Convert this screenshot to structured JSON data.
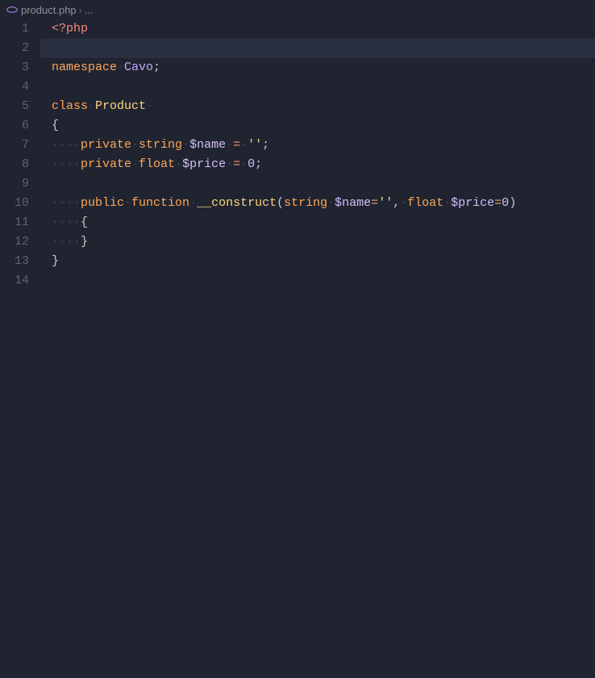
{
  "breadcrumb": {
    "filename": "product.php",
    "sep": "›",
    "tail": "..."
  },
  "iconColor": "#a074c4",
  "currentLine": 2,
  "lines": [
    {
      "n": 1,
      "tokens": [
        {
          "c": "tk-tag",
          "t": "<?php"
        }
      ]
    },
    {
      "n": 2,
      "tokens": []
    },
    {
      "n": 3,
      "tokens": [
        {
          "c": "tk-keyword",
          "t": "namespace"
        },
        {
          "c": "tk-ws",
          "t": "·"
        },
        {
          "c": "tk-ns",
          "t": "Cavo"
        },
        {
          "c": "tk-punct",
          "t": ";"
        }
      ]
    },
    {
      "n": 4,
      "tokens": []
    },
    {
      "n": 5,
      "tokens": [
        {
          "c": "tk-keyword",
          "t": "class"
        },
        {
          "c": "tk-ws",
          "t": "·"
        },
        {
          "c": "tk-class",
          "t": "Product"
        },
        {
          "c": "tk-ws",
          "t": "·"
        }
      ]
    },
    {
      "n": 6,
      "tokens": [
        {
          "c": "tk-punct",
          "t": "{"
        }
      ]
    },
    {
      "n": 7,
      "tokens": [
        {
          "c": "tk-ws",
          "t": "····"
        },
        {
          "c": "tk-keyword",
          "t": "private"
        },
        {
          "c": "tk-ws",
          "t": "·"
        },
        {
          "c": "tk-type",
          "t": "string"
        },
        {
          "c": "tk-ws",
          "t": "·"
        },
        {
          "c": "tk-var",
          "t": "$name"
        },
        {
          "c": "tk-ws",
          "t": "·"
        },
        {
          "c": "tk-op",
          "t": "="
        },
        {
          "c": "tk-ws",
          "t": "·"
        },
        {
          "c": "tk-str",
          "t": "''"
        },
        {
          "c": "tk-punct",
          "t": ";"
        }
      ]
    },
    {
      "n": 8,
      "tokens": [
        {
          "c": "tk-ws",
          "t": "····"
        },
        {
          "c": "tk-keyword",
          "t": "private"
        },
        {
          "c": "tk-ws",
          "t": "·"
        },
        {
          "c": "tk-type",
          "t": "float"
        },
        {
          "c": "tk-ws",
          "t": "·"
        },
        {
          "c": "tk-var",
          "t": "$price"
        },
        {
          "c": "tk-ws",
          "t": "·"
        },
        {
          "c": "tk-op",
          "t": "="
        },
        {
          "c": "tk-ws",
          "t": "·"
        },
        {
          "c": "tk-num",
          "t": "0"
        },
        {
          "c": "tk-punct",
          "t": ";"
        }
      ]
    },
    {
      "n": 9,
      "tokens": []
    },
    {
      "n": 10,
      "tokens": [
        {
          "c": "tk-ws",
          "t": "····"
        },
        {
          "c": "tk-keyword",
          "t": "public"
        },
        {
          "c": "tk-ws",
          "t": "·"
        },
        {
          "c": "tk-keyword",
          "t": "function"
        },
        {
          "c": "tk-ws",
          "t": "·"
        },
        {
          "c": "tk-func",
          "t": "__construct"
        },
        {
          "c": "tk-punct",
          "t": "("
        },
        {
          "c": "tk-type",
          "t": "string"
        },
        {
          "c": "tk-ws",
          "t": "·"
        },
        {
          "c": "tk-var",
          "t": "$name"
        },
        {
          "c": "tk-op",
          "t": "="
        },
        {
          "c": "tk-str",
          "t": "''"
        },
        {
          "c": "tk-punct",
          "t": ","
        },
        {
          "c": "tk-ws",
          "t": "·"
        },
        {
          "c": "tk-type",
          "t": "float"
        },
        {
          "c": "tk-ws",
          "t": "·"
        },
        {
          "c": "tk-var",
          "t": "$price"
        },
        {
          "c": "tk-op",
          "t": "="
        },
        {
          "c": "tk-num",
          "t": "0"
        },
        {
          "c": "tk-punct",
          "t": ")"
        }
      ]
    },
    {
      "n": 11,
      "tokens": [
        {
          "c": "tk-ws",
          "t": "····"
        },
        {
          "c": "tk-punct",
          "t": "{"
        }
      ]
    },
    {
      "n": 12,
      "tokens": [
        {
          "c": "tk-ws",
          "t": "····"
        },
        {
          "c": "tk-punct",
          "t": "}"
        }
      ]
    },
    {
      "n": 13,
      "tokens": [
        {
          "c": "tk-punct",
          "t": "}"
        }
      ]
    },
    {
      "n": 14,
      "tokens": []
    }
  ]
}
